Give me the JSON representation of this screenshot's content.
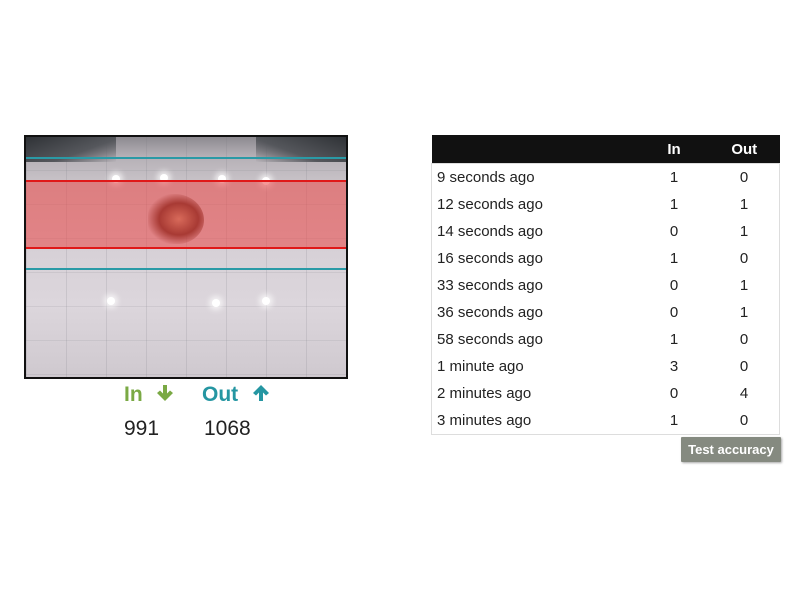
{
  "camera": {
    "description": "Overhead camera feed with counting zones",
    "zone_colors": {
      "detection_zone": "#e01818",
      "boundary_lines": "#2a9aa6"
    }
  },
  "counters": {
    "in": {
      "label": "In",
      "icon": "arrow-down-icon",
      "color": "#7aa944",
      "value": "991"
    },
    "out": {
      "label": "Out",
      "icon": "arrow-up-icon",
      "color": "#2596a2",
      "value": "1068"
    }
  },
  "history": {
    "headers": {
      "time": "",
      "in": "In",
      "out": "Out"
    },
    "rows": [
      {
        "time": "9 seconds ago",
        "in": "1",
        "out": "0"
      },
      {
        "time": "12 seconds ago",
        "in": "1",
        "out": "1"
      },
      {
        "time": "14 seconds ago",
        "in": "0",
        "out": "1"
      },
      {
        "time": "16 seconds ago",
        "in": "1",
        "out": "0"
      },
      {
        "time": "33 seconds ago",
        "in": "0",
        "out": "1"
      },
      {
        "time": "36 seconds ago",
        "in": "0",
        "out": "1"
      },
      {
        "time": "58 seconds ago",
        "in": "1",
        "out": "0"
      },
      {
        "time": "1 minute ago",
        "in": "3",
        "out": "0"
      },
      {
        "time": "2 minutes ago",
        "in": "0",
        "out": "4"
      },
      {
        "time": "3 minutes ago",
        "in": "1",
        "out": "0"
      }
    ]
  },
  "actions": {
    "test_accuracy_label": "Test accuracy"
  }
}
